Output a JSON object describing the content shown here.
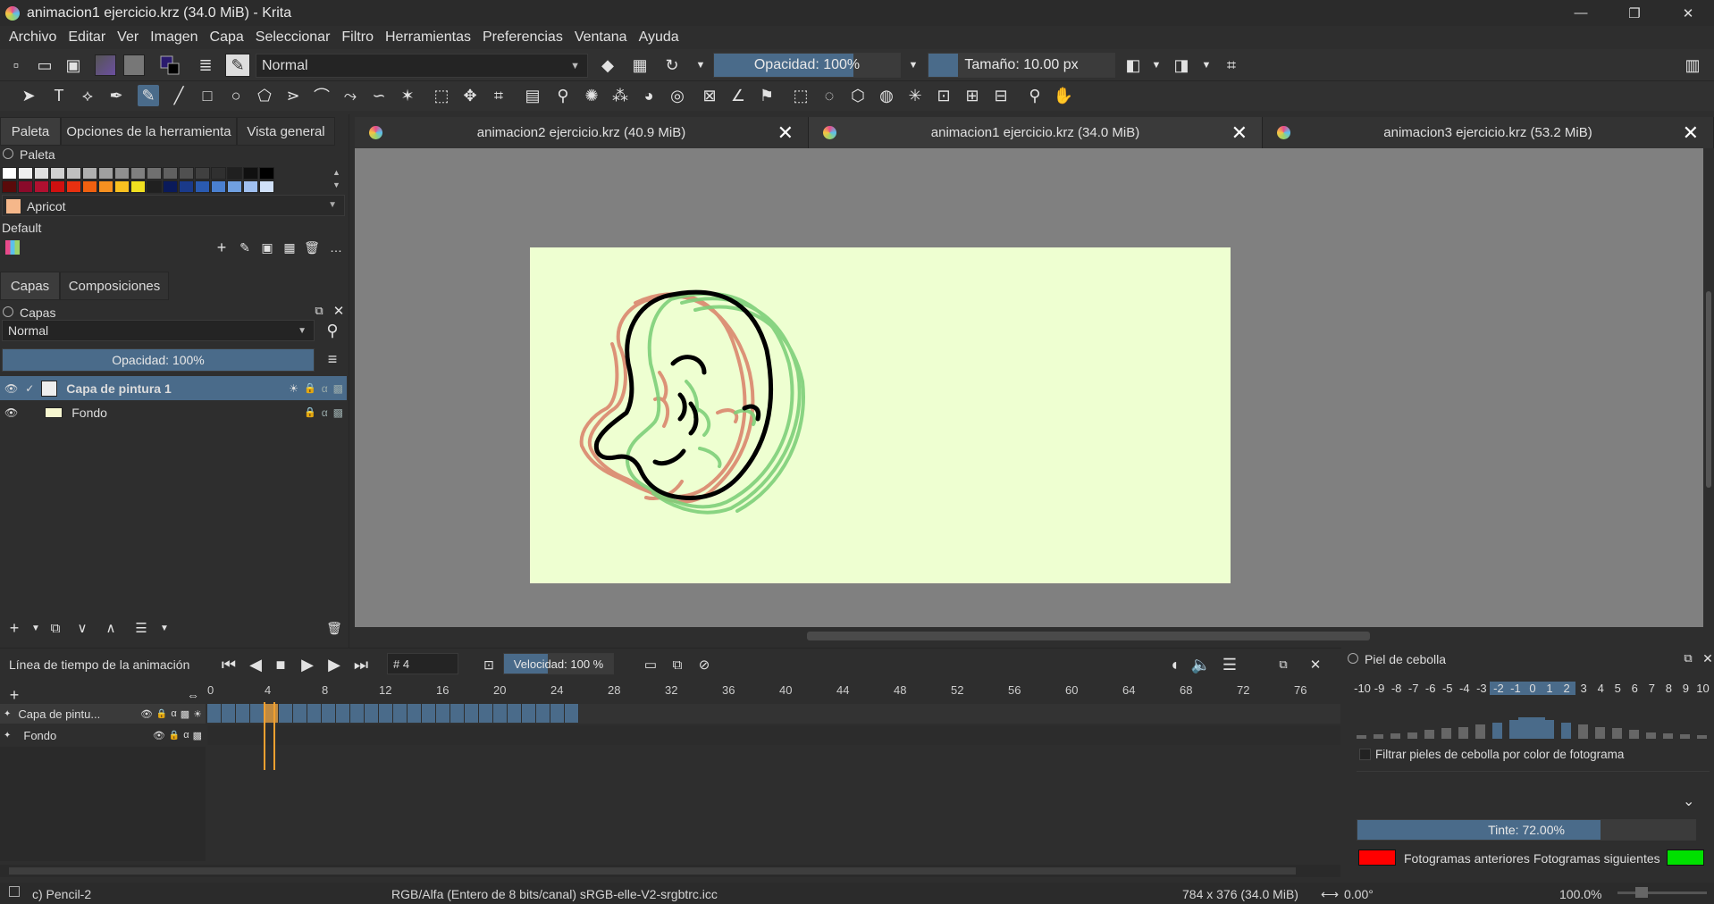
{
  "window": {
    "title": "animacion1 ejercicio.krz (34.0 MiB) - Krita",
    "minimize": "—",
    "maximize": "❐",
    "close": "✕"
  },
  "menu": [
    "Archivo",
    "Editar",
    "Ver",
    "Imagen",
    "Capa",
    "Seleccionar",
    "Filtro",
    "Herramientas",
    "Preferencias",
    "Ventana",
    "Ayuda"
  ],
  "toolbar": {
    "blend_mode": "Normal",
    "opacity": "Opacidad: 100%",
    "opacity_value": 1.0,
    "size": "Tamaño: 10.00 px",
    "size_value": 0.1
  },
  "left_tabs": [
    "Paleta",
    "Opciones de la herramienta",
    "Vista general"
  ],
  "palette": {
    "header": "Paleta",
    "current_color_name": "Apricot",
    "current_color": "#f5b78a",
    "palette_name": "Default",
    "row1": [
      "#ffffff",
      "#f0f0f0",
      "#e0e0e0",
      "#d0d0d0",
      "#c0c0c0",
      "#b0b0b0",
      "#a0a0a0",
      "#909090",
      "#808080",
      "#707070",
      "#606060",
      "#505050",
      "#404040",
      "#303030",
      "#202020",
      "#101010",
      "#000000"
    ],
    "row2": [
      "#5a0a0a",
      "#8a0a2a",
      "#b01030",
      "#d01010",
      "#e83010",
      "#f06010",
      "#f59020",
      "#f8c020",
      "#f0e020",
      "#202020",
      "#0a1a5a",
      "#1a3a8a",
      "#2a5ab0",
      "#4a80d0",
      "#70a0e0",
      "#a0c0f0",
      "#d0e0f8"
    ]
  },
  "layers_tabs": [
    "Capas",
    "Composiciones"
  ],
  "layers": {
    "header": "Capas",
    "blend_mode": "Normal",
    "opacity": "Opacidad:  100%",
    "opacity_value": 1.0,
    "items": [
      {
        "name": "Capa de pintura 1",
        "selected": true
      },
      {
        "name": "Fondo",
        "selected": false
      }
    ]
  },
  "doc_tabs": [
    {
      "label": "animacion2 ejercicio.krz (40.9 MiB)"
    },
    {
      "label": "animacion1 ejercicio.krz (34.0 MiB)"
    },
    {
      "label": "animacion3 ejercicio.krz (53.2 MiB)"
    }
  ],
  "canvas": {
    "paper_color": "#eeffd1"
  },
  "timeline": {
    "title": "Línea de tiempo de la animación",
    "frame_field": "# 4",
    "speed": "Velocidad: 100 %",
    "ruler": [
      "0",
      "4",
      "8",
      "12",
      "16",
      "20",
      "24",
      "28",
      "32",
      "36",
      "40",
      "44",
      "48",
      "52",
      "56",
      "60",
      "64",
      "68",
      "72",
      "76"
    ],
    "layers": [
      "Capa de pintu...",
      "Fondo"
    ],
    "current_frame": 4,
    "filled_frames": 26
  },
  "onion": {
    "title": "Piel de cebolla",
    "numbers": [
      "-10",
      "-9",
      "-8",
      "-7",
      "-6",
      "-5",
      "-4",
      "-3",
      "-2",
      "-1",
      "0",
      "1",
      "2",
      "3",
      "4",
      "5",
      "6",
      "7",
      "8",
      "9",
      "10"
    ],
    "bar_levels": [
      0.15,
      0.2,
      0.25,
      0.3,
      0.4,
      0.5,
      0.55,
      0.65,
      0.75,
      0.85,
      1.0,
      0.85,
      0.75,
      0.65,
      0.55,
      0.5,
      0.4,
      0.3,
      0.25,
      0.2,
      0.15
    ],
    "filter_label": "Filtrar pieles de cebolla por color de fotograma",
    "tint": "Tinte: 72.00%",
    "tint_value": 0.72,
    "prev_label": "Fotogramas anteriores",
    "next_label": "Fotogramas siguientes",
    "prev_color": "#ff0000",
    "next_color": "#00e000"
  },
  "status": {
    "brush": "c) Pencil-2",
    "color_space": "RGB/Alfa (Entero de 8 bits/canal)  sRGB-elle-V2-srgbtrc.icc",
    "dimensions": "784 x 376 (34.0 MiB)",
    "rotation": "0.00°",
    "zoom": "100.0%"
  }
}
